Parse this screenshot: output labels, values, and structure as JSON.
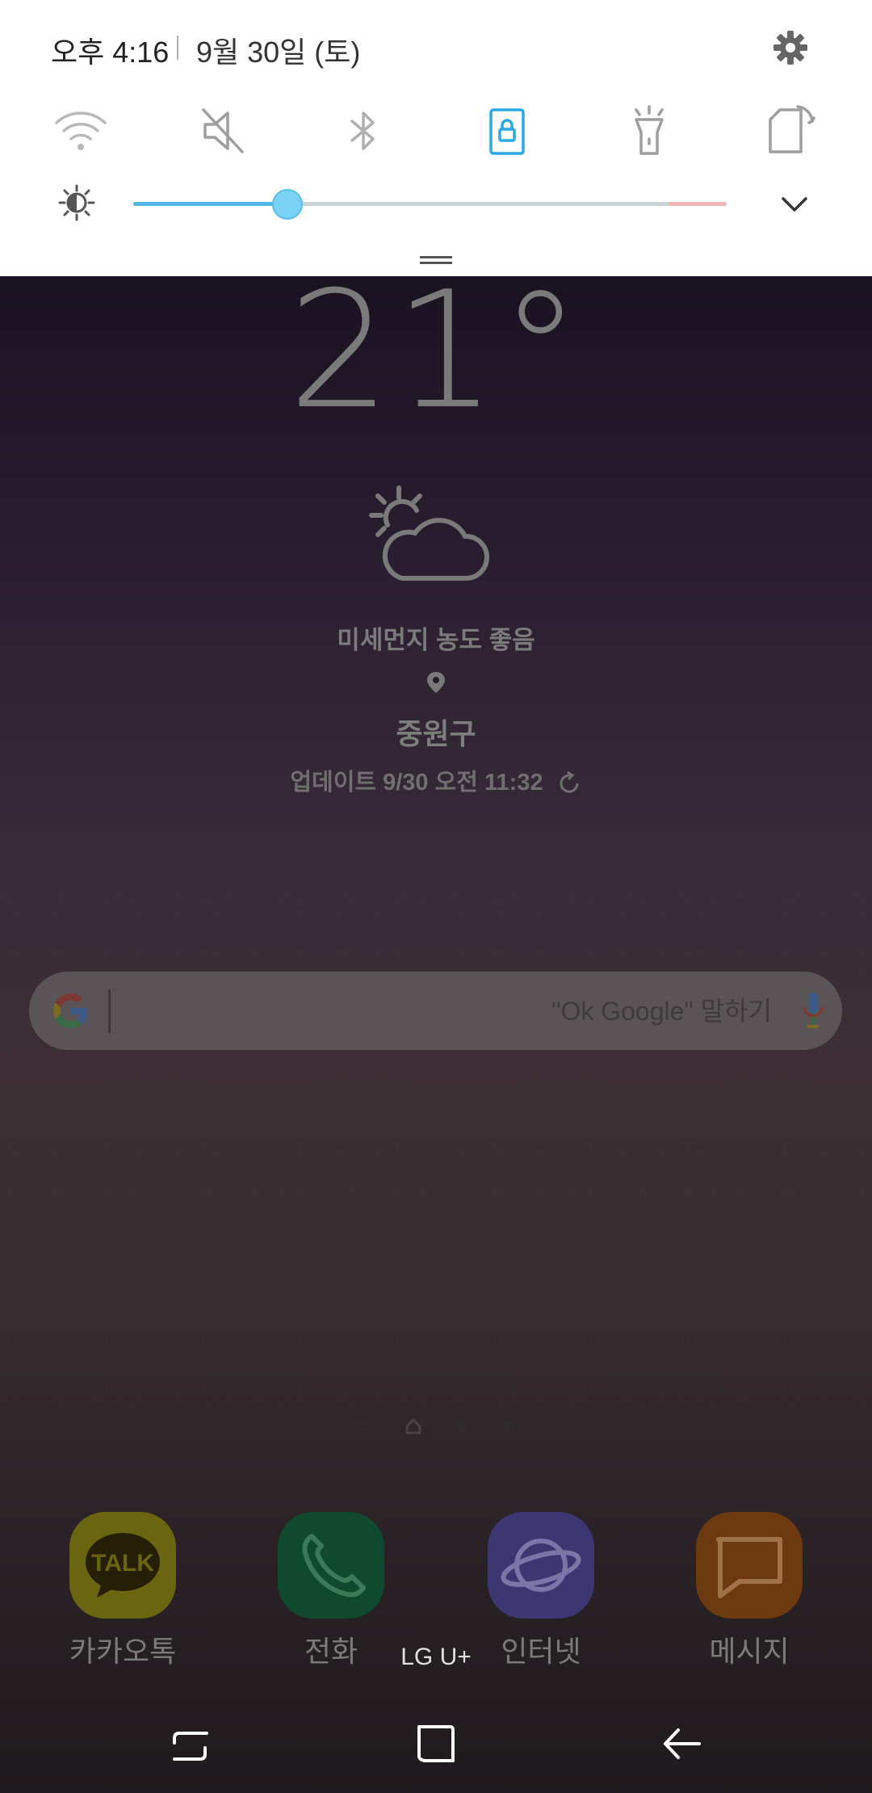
{
  "quick_panel": {
    "time": "오후 4:16",
    "date": "9월 30일 (토)",
    "tiles": [
      "wifi-icon",
      "sound-mute-icon",
      "bluetooth-icon",
      "screen-lock-icon",
      "flashlight-icon",
      "auto-rotate-icon"
    ],
    "brightness": {
      "level_fraction": 0.26
    },
    "colors": {
      "accent": "#4fb8e6",
      "active_tile": "#29a9e6",
      "inactive_tile": "#a9a9a9"
    }
  },
  "weather": {
    "temperature": "21°",
    "dust": "미세먼지 농도 좋음",
    "location": "중원구",
    "update": "업데이트 9/30 오전 11:32"
  },
  "search": {
    "placeholder": "\"Ok Google\" 말하기"
  },
  "pager": {
    "current_page": "home"
  },
  "dock": [
    {
      "label": "카카오톡",
      "icon": "kakaotalk-icon",
      "icon_text": "TALK"
    },
    {
      "label": "전화",
      "icon": "phone-icon"
    },
    {
      "label": "인터넷",
      "icon": "internet-icon"
    },
    {
      "label": "메시지",
      "icon": "messages-icon"
    }
  ],
  "carrier": "LG U+",
  "navbar": [
    "recent-apps-icon",
    "home-icon",
    "back-icon"
  ]
}
